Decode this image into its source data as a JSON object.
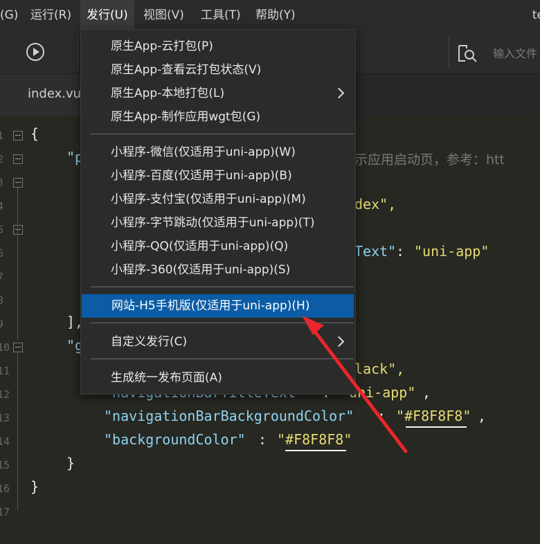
{
  "menubar": {
    "items": [
      {
        "label": "(G)"
      },
      {
        "label": "运行(R)"
      },
      {
        "label": "发行(U)"
      },
      {
        "label": "视图(V)"
      },
      {
        "label": "工具(T)"
      },
      {
        "label": "帮助(Y)"
      }
    ],
    "window_title": "te"
  },
  "toolbar": {
    "run_icon": "play-circle-icon",
    "search_icon": "search-icon",
    "search_placeholder": "输入文件"
  },
  "tabs": [
    {
      "label": "index.vue"
    }
  ],
  "editor": {
    "line_numbers": [
      "1",
      "2",
      "3",
      "4",
      "5",
      "6",
      "7",
      "8",
      "9",
      "10",
      "11",
      "12",
      "13",
      "14",
      "15",
      "16",
      "17"
    ],
    "lines": {
      "l1": "{",
      "l2_key": "\"p",
      "l2_comment": "示应用启动页，参考：htt",
      "l4_tail": "dex\",",
      "l6_key": "Text\"",
      "l6_colon": ": ",
      "l6_value": "\"uni-app\"",
      "l9": "],",
      "l10_key": "\"g",
      "l11_tail": "black\",",
      "l12_key": "\"navigationBarTitleText\"",
      "l12_colon": ": ",
      "l12_value": "\"uni-app\"",
      "l12_comma": ",",
      "l13_key": "\"navigationBarBackgroundColor\"",
      "l13_colon": ": ",
      "l13_value": "\"#F8F8F8\"",
      "l13_comma": ",",
      "l14_key": "\"backgroundColor\"",
      "l14_colon": ": ",
      "l14_value": "\"#F8F8F8\"",
      "l15": "}",
      "l16": "}"
    }
  },
  "dropdown": {
    "group1": [
      {
        "label": "原生App-云打包(P)"
      },
      {
        "label": "原生App-查看云打包状态(V)"
      },
      {
        "label": "原生App-本地打包(L)"
      },
      {
        "label": "原生App-制作应用wgt包(G)"
      }
    ],
    "group2": [
      {
        "label": "小程序-微信(仅适用于uni-app)(W)"
      },
      {
        "label": "小程序-百度(仅适用于uni-app)(B)"
      },
      {
        "label": "小程序-支付宝(仅适用于uni-app)(M)"
      },
      {
        "label": "小程序-字节跳动(仅适用于uni-app)(T)"
      },
      {
        "label": "小程序-QQ(仅适用于uni-app)(Q)"
      },
      {
        "label": "小程序-360(仅适用于uni-app)(S)"
      }
    ],
    "group3": [
      {
        "label": "网站-H5手机版(仅适用于uni-app)(H)"
      }
    ],
    "group4": [
      {
        "label": "自定义发行(C)"
      }
    ],
    "group5": [
      {
        "label": "生成统一发布页面(A)"
      }
    ]
  },
  "colors": {
    "highlight": "#0b5ca5",
    "annotation_arrow": "#e8262b"
  }
}
